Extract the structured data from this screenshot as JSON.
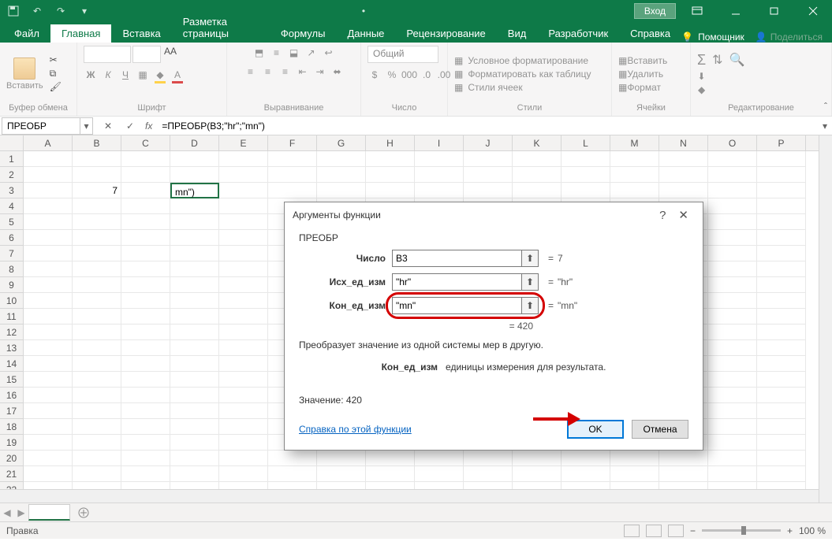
{
  "titlebar": {
    "login": "Вход"
  },
  "tabs": {
    "file": "Файл",
    "home": "Главная",
    "insert": "Вставка",
    "layout": "Разметка страницы",
    "formulas": "Формулы",
    "data": "Данные",
    "review": "Рецензирование",
    "view": "Вид",
    "developer": "Разработчик",
    "help": "Справка",
    "tellme": "Помощник",
    "share": "Поделиться"
  },
  "ribbon": {
    "paste": "Вставить",
    "clipboard": "Буфер обмена",
    "font": "Шрифт",
    "align": "Выравнивание",
    "number": "Число",
    "number_format": "Общий",
    "styles": "Стили",
    "cond_fmt": "Условное форматирование",
    "fmt_table": "Форматировать как таблицу",
    "cell_styles": "Стили ячеек",
    "cells": "Ячейки",
    "insert_c": "Вставить",
    "delete_c": "Удалить",
    "format_c": "Формат",
    "editing": "Редактирование",
    "bold": "Ж",
    "italic": "К",
    "underline": "Ч"
  },
  "formula_bar": {
    "name": "ПРЕОБР",
    "formula": "=ПРЕОБР(B3;\"hr\";\"mn\")"
  },
  "sheet": {
    "cols": [
      "A",
      "B",
      "C",
      "D",
      "E",
      "F",
      "G",
      "H",
      "I",
      "J",
      "K",
      "L",
      "M",
      "N",
      "O",
      "P"
    ],
    "rows": 22,
    "b3": "7",
    "d3": "mn\")"
  },
  "sheet_tabs": {
    "add": "+"
  },
  "statusbar": {
    "mode": "Правка",
    "zoom": "100 %"
  },
  "dialog": {
    "title": "Аргументы функции",
    "func": "ПРЕОБР",
    "arg1_label": "Число",
    "arg1_value": "B3",
    "arg1_result": "7",
    "arg2_label": "Исх_ед_изм",
    "arg2_value": "\"hr\"",
    "arg2_result": "\"hr\"",
    "arg3_label": "Кон_ед_изм",
    "arg3_value": "\"mn\"",
    "arg3_result": "\"mn\"",
    "eq": "=",
    "result_label": "= ",
    "result": "420",
    "desc": "Преобразует значение из одной системы мер в другую.",
    "arg_desc_label": "Кон_ед_изм",
    "arg_desc": "единицы измерения для результата.",
    "value_label": "Значение:",
    "value": "420",
    "help": "Справка по этой функции",
    "ok": "OK",
    "cancel": "Отмена"
  }
}
